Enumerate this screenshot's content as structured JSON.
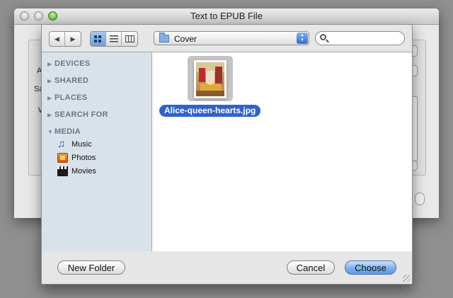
{
  "parent_window": {
    "title": "Text to EPUB File",
    "fragments": [
      "A",
      "Sa",
      "W"
    ]
  },
  "toolbar": {
    "back_icon": "back-arrow-icon",
    "forward_icon": "forward-arrow-icon",
    "views": [
      "icon-view-icon",
      "list-view-icon",
      "column-view-icon"
    ],
    "active_view": 0,
    "folder": "Cover",
    "search_value": ""
  },
  "sidebar": {
    "sections": [
      {
        "label": "DEVICES",
        "expanded": false
      },
      {
        "label": "SHARED",
        "expanded": false
      },
      {
        "label": "PLACES",
        "expanded": false
      },
      {
        "label": "SEARCH FOR",
        "expanded": false
      },
      {
        "label": "MEDIA",
        "expanded": true
      }
    ],
    "media_items": [
      {
        "label": "Music",
        "icon": "music-note-icon"
      },
      {
        "label": "Photos",
        "icon": "photos-icon"
      },
      {
        "label": "Movies",
        "icon": "movies-icon"
      }
    ]
  },
  "files": [
    {
      "name": "Alice-queen-hearts.jpg",
      "selected": true
    }
  ],
  "buttons": {
    "new_folder": "New Folder",
    "cancel": "Cancel",
    "choose": "Choose"
  },
  "colors": {
    "selection": "#2f64c5",
    "sidebar_bg": "#d9e1ea",
    "default_button": "#7fb0ef"
  }
}
